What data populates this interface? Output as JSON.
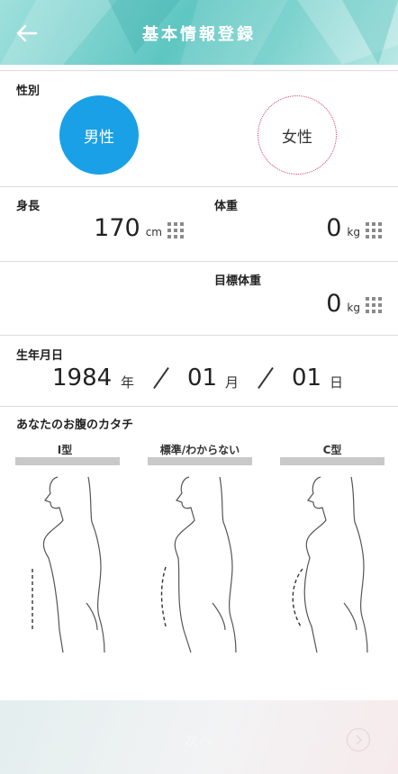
{
  "header": {
    "title": "基本情報登録",
    "back_icon": "arrow-left-icon"
  },
  "gender": {
    "label": "性別",
    "male": "男性",
    "female": "女性",
    "selected": "male",
    "male_color": "#1aa0e6",
    "female_border": "#d23a78"
  },
  "height": {
    "label": "身長",
    "value": "170",
    "unit": "cm"
  },
  "weight": {
    "label": "体重",
    "value": "0",
    "unit": "kg"
  },
  "target_weight": {
    "label": "目標体重",
    "value": "0",
    "unit": "kg"
  },
  "birthday": {
    "label": "生年月日",
    "year": "1984",
    "year_unit": "年",
    "month": "01",
    "month_unit": "月",
    "day": "01",
    "day_unit": "日"
  },
  "belly": {
    "label": "あなたのお腹のカタチ",
    "types": [
      {
        "label": "I型"
      },
      {
        "label": "標準/わからない"
      },
      {
        "label": "C型"
      }
    ]
  },
  "footer": {
    "next_label": "次へ"
  },
  "colors": {
    "header": "#5fc6c2",
    "accent": "#1aa0e6"
  }
}
